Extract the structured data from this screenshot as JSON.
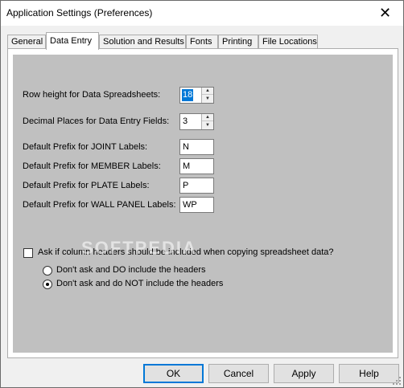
{
  "window": {
    "title": "Application Settings (Preferences)",
    "close_glyph": "✕"
  },
  "tabs": [
    {
      "label": "General"
    },
    {
      "label": "Data Entry"
    },
    {
      "label": "Solution and Results"
    },
    {
      "label": "Fonts"
    },
    {
      "label": "Printing"
    },
    {
      "label": "File Locations"
    }
  ],
  "active_tab": "Data Entry",
  "fields": {
    "row_height": {
      "label": "Row height for Data Spreadsheets:",
      "value": "18"
    },
    "decimal_places": {
      "label": "Decimal Places for Data Entry Fields:",
      "value": "3"
    },
    "joint_prefix": {
      "label": "Default Prefix for JOINT Labels:",
      "value": "N"
    },
    "member_prefix": {
      "label": "Default Prefix for MEMBER Labels:",
      "value": "M"
    },
    "plate_prefix": {
      "label": "Default Prefix for PLATE Labels:",
      "value": "P"
    },
    "wall_panel_prefix": {
      "label": "Default Prefix for WALL PANEL Labels:",
      "value": "WP"
    }
  },
  "ask_headers": {
    "label": "Ask if column headers should be included when copying spreadsheet data?",
    "checked": false
  },
  "radios": [
    {
      "label": "Don't ask and DO include the headers",
      "selected": false
    },
    {
      "label": "Don't ask and do NOT include the headers",
      "selected": true
    }
  ],
  "watermark": "SOFTPEDIA",
  "buttons": {
    "ok": "OK",
    "cancel": "Cancel",
    "apply": "Apply",
    "help": "Help"
  },
  "colors": {
    "panel_gray": "#c0c0c0",
    "selection": "#0078d7",
    "window_bg": "#f0f0f0"
  },
  "icons": {
    "spin_up": "▲",
    "spin_down": "▼"
  }
}
